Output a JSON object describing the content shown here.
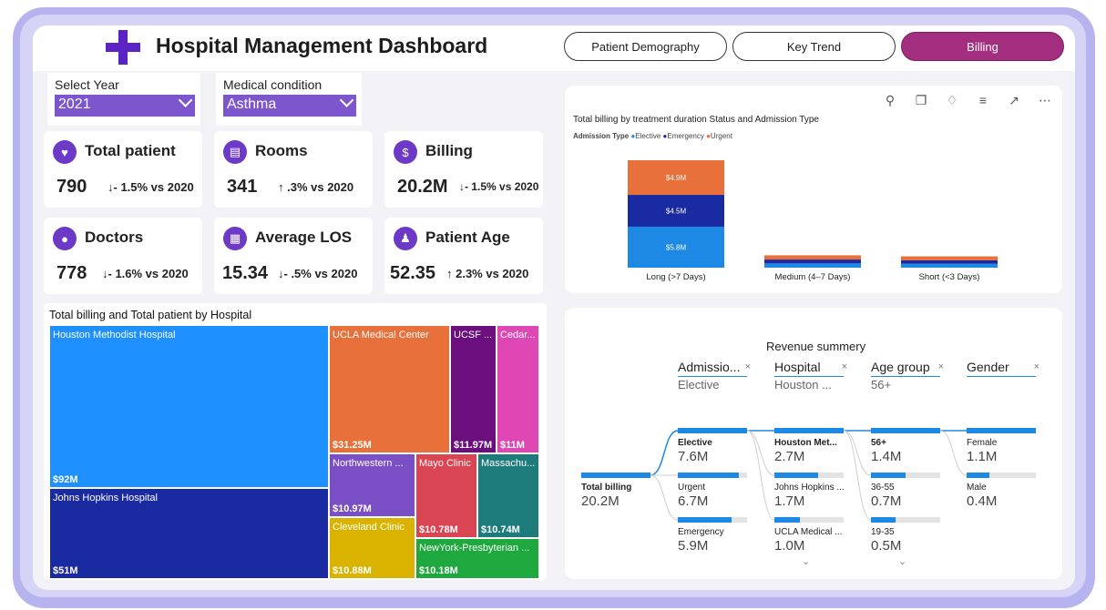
{
  "header": {
    "title": "Hospital Management Dashboard",
    "tabs": [
      "Patient Demography",
      "Key Trend",
      "Billing"
    ],
    "active_tab": "Billing"
  },
  "filters": {
    "year": {
      "label": "Select Year",
      "value": "2021"
    },
    "condition": {
      "label": "Medical condition",
      "value": "Asthma"
    }
  },
  "kpis": [
    {
      "title": "Total patient",
      "value": "790",
      "change": "↓- 1.5% vs 2020",
      "icon": "patient-icon"
    },
    {
      "title": "Rooms",
      "value": "341",
      "change": "↑ .3% vs 2020",
      "icon": "bed-icon"
    },
    {
      "title": "Billing",
      "value": "20.2M",
      "change": "↓- 1.5% vs 2020",
      "icon": "money-bag-icon"
    },
    {
      "title": "Doctors",
      "value": "778",
      "change": "↓- 1.6% vs 2020",
      "icon": "doctor-icon"
    },
    {
      "title": "Average LOS",
      "value": "15.34",
      "change": "↓- .5% vs 2020",
      "icon": "calendar-icon"
    },
    {
      "title": "Patient Age",
      "value": "52.35",
      "change": "↑ 2.3% vs 2020",
      "icon": "family-icon"
    }
  ],
  "colors": {
    "purple": "#5b22c4",
    "active_tab": "#a32d7e",
    "elective": "#1e88e5",
    "emergency": "#1a2aa0",
    "urgent": "#e8703a"
  },
  "chart_data": [
    {
      "type": "bar",
      "stacked": true,
      "title": "Total billing by treatment duration Status and Admission Type",
      "legend_title": "Admission Type",
      "legend_position": "top-left",
      "categories": [
        "Long (>7 Days)",
        "Medium (4–7 Days)",
        "Short (<3 Days)"
      ],
      "series": [
        {
          "name": "Elective",
          "color": "#1e88e5",
          "values": [
            5.8,
            0.6,
            0.55
          ],
          "labels": [
            "$5.8M",
            "",
            ""
          ]
        },
        {
          "name": "Emergency",
          "color": "#1a2aa0",
          "values": [
            4.5,
            0.55,
            0.5
          ],
          "labels": [
            "$4.5M",
            "",
            ""
          ]
        },
        {
          "name": "Urgent",
          "color": "#e8703a",
          "values": [
            4.9,
            0.6,
            0.55
          ],
          "labels": [
            "$4.9M",
            "",
            ""
          ]
        }
      ],
      "ylim": [
        0,
        15.2
      ]
    },
    {
      "type": "treemap",
      "title": "Total billing and Total patient by Hospital",
      "items": [
        {
          "name": "Houston Methodist Hospital",
          "value": 92,
          "label": "$92M",
          "color": "#1e90ff"
        },
        {
          "name": "Johns Hopkins Hospital",
          "value": 51,
          "label": "$51M",
          "color": "#1a2aa0"
        },
        {
          "name": "UCLA Medical Center",
          "value": 31.25,
          "label": "$31.25M",
          "color": "#e8703a"
        },
        {
          "name": "UCSF ...",
          "value": 11.97,
          "label": "$11.97M",
          "color": "#6b0f7e"
        },
        {
          "name": "Cedar...",
          "value": 11,
          "label": "$11M",
          "color": "#de47b4"
        },
        {
          "name": "Northwestern ...",
          "value": 10.97,
          "label": "$10.97M",
          "color": "#7a4fc5"
        },
        {
          "name": "Cleveland Clinic",
          "value": 10.88,
          "label": "$10.88M",
          "color": "#d9b300"
        },
        {
          "name": "Mayo Clinic",
          "value": 10.78,
          "label": "$10.78M",
          "color": "#d94553"
        },
        {
          "name": "Massachu...",
          "value": 10.74,
          "label": "$10.74M",
          "color": "#1e7b7b"
        },
        {
          "name": "NewYork-Presbyterian ...",
          "value": 10.18,
          "label": "$10.18M",
          "color": "#1fa83e"
        }
      ]
    }
  ],
  "revenue_summary": {
    "title": "Revenue summery",
    "levels": [
      {
        "head": "Admissio...",
        "selected": "Elective"
      },
      {
        "head": "Hospital",
        "selected": "Houston ..."
      },
      {
        "head": "Age group",
        "selected": "56+"
      },
      {
        "head": "Gender",
        "selected": ""
      }
    ],
    "root": {
      "label": "Total billing",
      "value": "20.2M"
    },
    "columns": [
      [
        {
          "label": "Elective",
          "value": "7.6M",
          "fill": 1.0,
          "bold": true
        },
        {
          "label": "Urgent",
          "value": "6.7M",
          "fill": 0.88
        },
        {
          "label": "Emergency",
          "value": "5.9M",
          "fill": 0.78
        }
      ],
      [
        {
          "label": "Houston Met...",
          "value": "2.7M",
          "fill": 1.0,
          "bold": true
        },
        {
          "label": "Johns Hopkins ...",
          "value": "1.7M",
          "fill": 0.63
        },
        {
          "label": "UCLA Medical ...",
          "value": "1.0M",
          "fill": 0.37
        }
      ],
      [
        {
          "label": "56+",
          "value": "1.4M",
          "fill": 1.0,
          "bold": true
        },
        {
          "label": "36-55",
          "value": "0.7M",
          "fill": 0.5
        },
        {
          "label": "19-35",
          "value": "0.5M",
          "fill": 0.36
        }
      ],
      [
        {
          "label": "Female",
          "value": "1.1M",
          "fill": 1.0
        },
        {
          "label": "Male",
          "value": "0.4M",
          "fill": 0.33
        }
      ]
    ]
  }
}
